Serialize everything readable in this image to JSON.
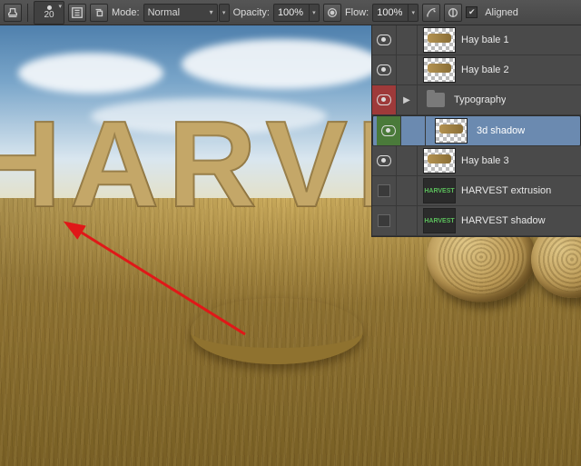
{
  "toolbar": {
    "brush_size": "20",
    "mode_label": "Mode:",
    "mode_value": "Normal",
    "opacity_label": "Opacity:",
    "opacity_value": "100%",
    "flow_label": "Flow:",
    "flow_value": "100%",
    "aligned_label": "Aligned",
    "aligned_checked": true
  },
  "layers": [
    {
      "visible": true,
      "vis_color": "",
      "folder": false,
      "name": "Hay bale 1",
      "selected": false,
      "thumb": "checker"
    },
    {
      "visible": true,
      "vis_color": "",
      "folder": false,
      "name": "Hay bale 2",
      "selected": false,
      "thumb": "checker"
    },
    {
      "visible": true,
      "vis_color": "red",
      "folder": true,
      "name": "Typography",
      "selected": false,
      "thumb": "folder"
    },
    {
      "visible": true,
      "vis_color": "green",
      "folder": false,
      "name": "3d shadow",
      "selected": true,
      "thumb": "checker"
    },
    {
      "visible": true,
      "vis_color": "",
      "folder": false,
      "name": "Hay bale 3",
      "selected": false,
      "thumb": "checker"
    },
    {
      "visible": false,
      "vis_color": "",
      "folder": false,
      "name": "HARVEST extrusion",
      "selected": false,
      "thumb": "text"
    },
    {
      "visible": false,
      "vis_color": "",
      "folder": false,
      "name": "HARVEST shadow",
      "selected": false,
      "thumb": "text"
    }
  ],
  "canvas": {
    "text": "HARVEST",
    "arrow_color": "#e01818"
  }
}
